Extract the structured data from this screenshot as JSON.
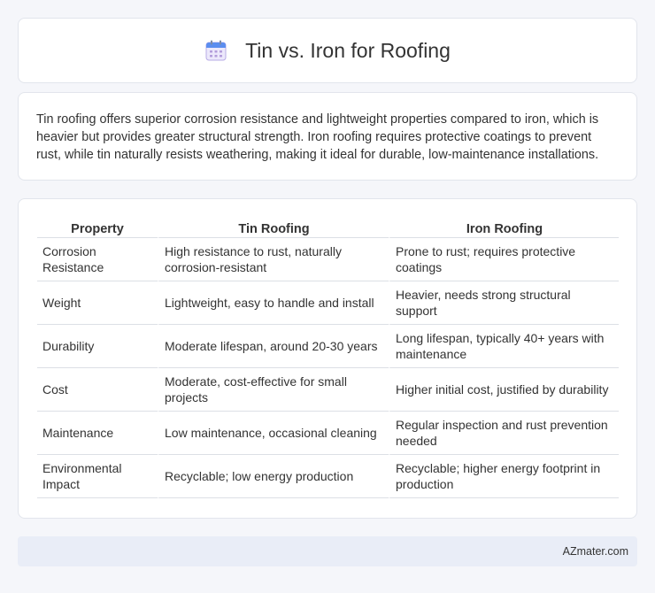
{
  "header": {
    "icon": "calendar-icon",
    "title": "Tin vs. Iron for Roofing"
  },
  "intro": {
    "text": "Tin roofing offers superior corrosion resistance and lightweight properties compared to iron, which is heavier but provides greater structural strength. Iron roofing requires protective coatings to prevent rust, while tin naturally resists weathering, making it ideal for durable, low-maintenance installations."
  },
  "table": {
    "headers": [
      "Property",
      "Tin Roofing",
      "Iron Roofing"
    ],
    "rows": [
      [
        "Corrosion Resistance",
        "High resistance to rust, naturally corrosion-resistant",
        "Prone to rust; requires protective coatings"
      ],
      [
        "Weight",
        "Lightweight, easy to handle and install",
        "Heavier, needs strong structural support"
      ],
      [
        "Durability",
        "Moderate lifespan, around 20-30 years",
        "Long lifespan, typically 40+ years with maintenance"
      ],
      [
        "Cost",
        "Moderate, cost-effective for small projects",
        "Higher initial cost, justified by durability"
      ],
      [
        "Maintenance",
        "Low maintenance, occasional cleaning",
        "Regular inspection and rust prevention needed"
      ],
      [
        "Environmental Impact",
        "Recyclable; low energy production",
        "Recyclable; higher energy footprint in production"
      ]
    ]
  },
  "footer": {
    "source": "AZmater.com"
  }
}
